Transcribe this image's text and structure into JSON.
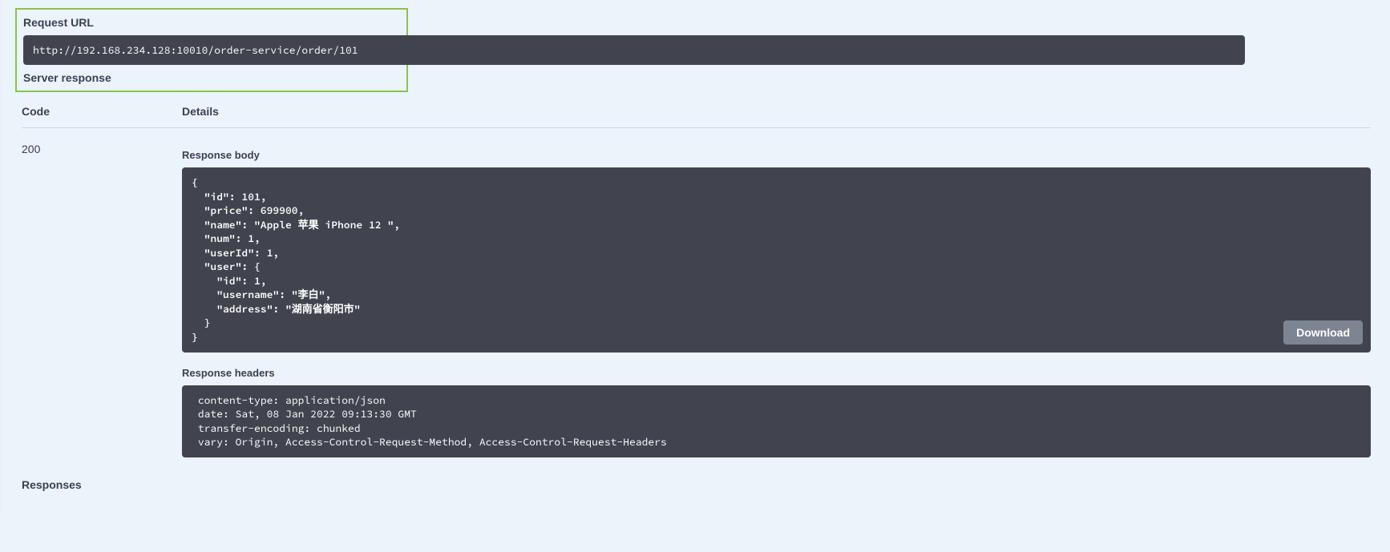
{
  "section": {
    "request_url_label": "Request URL",
    "server_response_label": "Server response",
    "code_header": "Code",
    "details_header": "Details",
    "responses_label": "Responses"
  },
  "request": {
    "url": "http://192.168.234.128:10010/order-service/order/101"
  },
  "response": {
    "status_code": "200",
    "body_label": "Response body",
    "headers_label": "Response headers",
    "download_label": "Download",
    "body_text": "{\n  \"id\": 101,\n  \"price\": 699900,\n  \"name\": \"Apple 苹果 iPhone 12 \",\n  \"num\": 1,\n  \"userId\": 1,\n  \"user\": {\n    \"id\": 1,\n    \"username\": \"李白\",\n    \"address\": \"湖南省衡阳市\"\n  }\n}",
    "headers_text": " content-type: application/json \n date: Sat, 08 Jan 2022 09:13:30 GMT \n transfer-encoding: chunked \n vary: Origin, Access-Control-Request-Method, Access-Control-Request-Headers "
  }
}
